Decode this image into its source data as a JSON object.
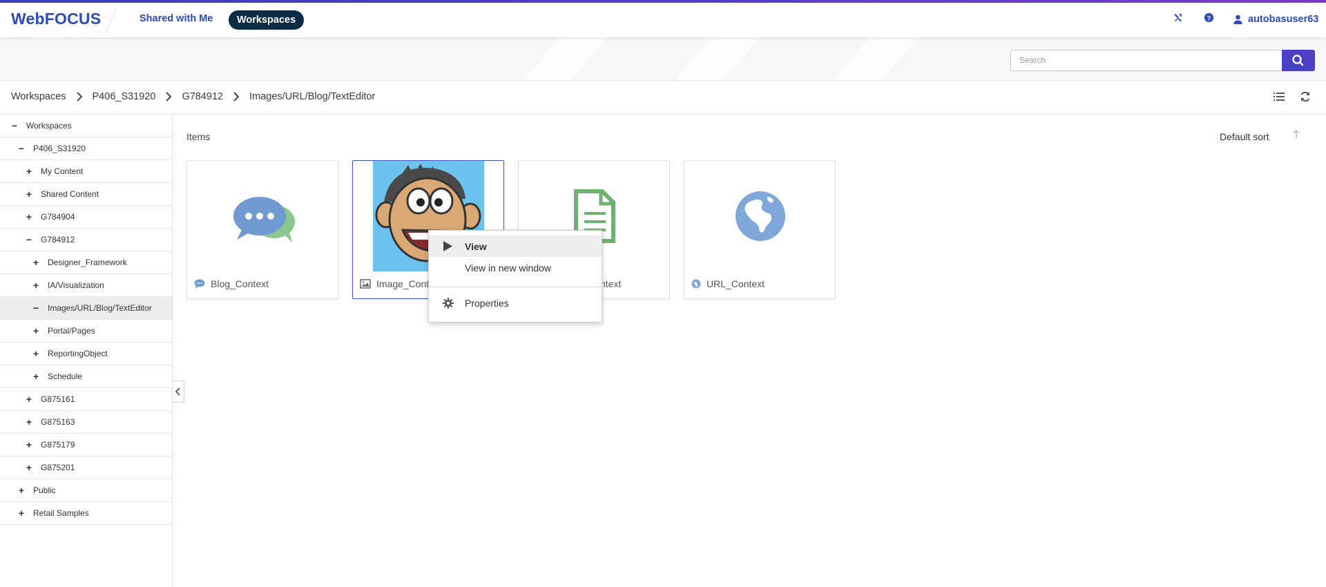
{
  "app": {
    "logo": "WebFOCUS",
    "user": "autobasuser63"
  },
  "nav": {
    "shared": "Shared with Me",
    "workspaces": "Workspaces"
  },
  "search": {
    "placeholder": "Search"
  },
  "breadcrumb": [
    "Workspaces",
    "P406_S31920",
    "G784912",
    "Images/URL/Blog/TextEditor"
  ],
  "tree": [
    {
      "label": "Workspaces",
      "toggle": "−",
      "level": 0
    },
    {
      "label": "P406_S31920",
      "toggle": "−",
      "level": 1
    },
    {
      "label": "My Content",
      "toggle": "+",
      "level": 2
    },
    {
      "label": "Shared Content",
      "toggle": "+",
      "level": 2
    },
    {
      "label": "G784904",
      "toggle": "+",
      "level": 2
    },
    {
      "label": "G784912",
      "toggle": "−",
      "level": 2
    },
    {
      "label": "Designer_Framework",
      "toggle": "+",
      "level": 3
    },
    {
      "label": "IA/Visualization",
      "toggle": "+",
      "level": 3
    },
    {
      "label": "Images/URL/Blog/TextEditor",
      "toggle": "−",
      "level": 3
    },
    {
      "label": "Portal/Pages",
      "toggle": "+",
      "level": 3
    },
    {
      "label": "ReportingObject",
      "toggle": "+",
      "level": 3
    },
    {
      "label": "Schedule",
      "toggle": "+",
      "level": 3
    },
    {
      "label": "G875161",
      "toggle": "+",
      "level": 2
    },
    {
      "label": "G875163",
      "toggle": "+",
      "level": 2
    },
    {
      "label": "G875179",
      "toggle": "+",
      "level": 2
    },
    {
      "label": "G875201",
      "toggle": "+",
      "level": 2
    },
    {
      "label": "Public",
      "toggle": "+",
      "level": 1
    },
    {
      "label": "Retail Samples",
      "toggle": "+",
      "level": 1
    }
  ],
  "main": {
    "items_label": "Items",
    "sort_label": "Default sort",
    "cards": [
      {
        "label": "Blog_Context",
        "icon": "chat-bubbles-icon"
      },
      {
        "label": "Image_Cont",
        "icon": "image-icon"
      },
      {
        "label": "ntext",
        "icon": "document-icon"
      },
      {
        "label": "URL_Context",
        "icon": "globe-icon"
      }
    ]
  },
  "context_menu": {
    "items": [
      "View",
      "View in new window",
      "Properties"
    ]
  },
  "colors": {
    "brand": "#2e49b8",
    "accent": "#4b3fc4",
    "nav_active": "#0c2b44"
  }
}
